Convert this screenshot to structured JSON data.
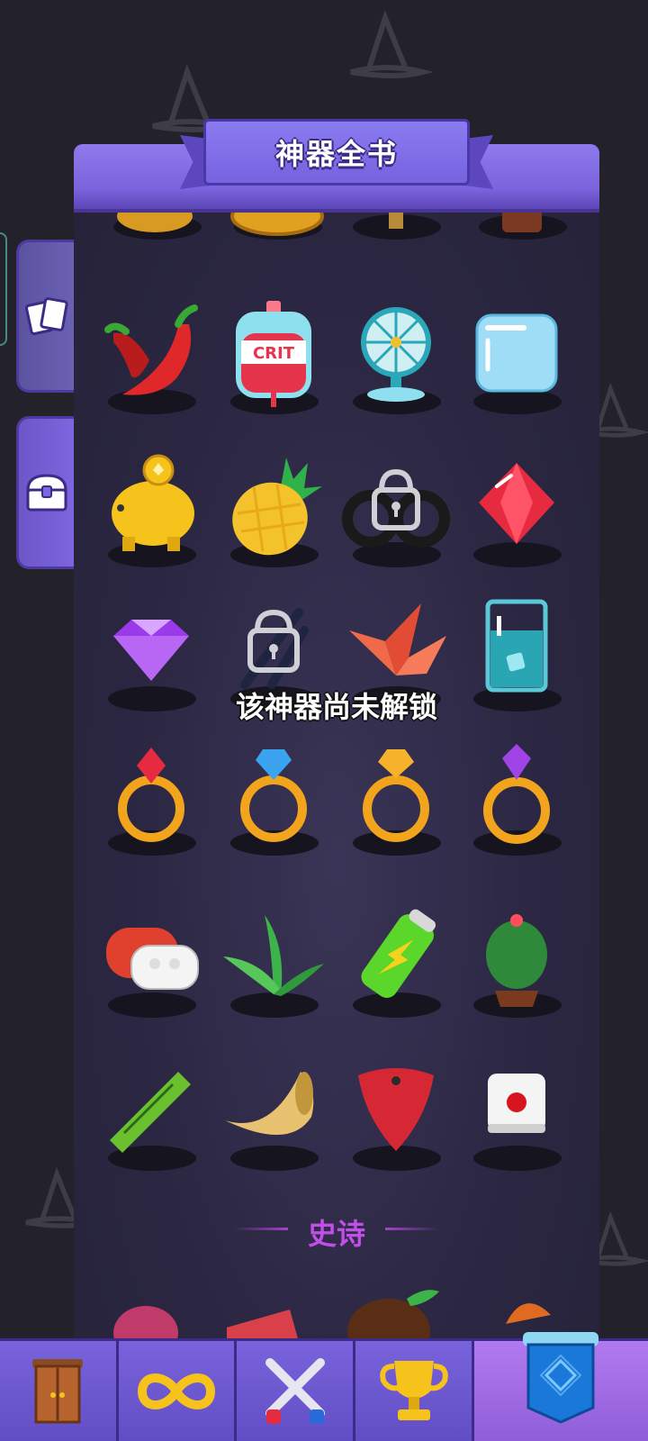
{
  "header": {
    "title": "神器全书"
  },
  "toast": {
    "locked_message": "该神器尚未解锁"
  },
  "section": {
    "epic_label": "史诗"
  },
  "side_tabs": [
    {
      "name": "cards",
      "icon": "cards-icon"
    },
    {
      "name": "chest",
      "icon": "chest-icon"
    }
  ],
  "artifacts": [
    {
      "name": "chili-pepper",
      "locked": false
    },
    {
      "name": "crit-blood-bag",
      "locked": false,
      "label": "CRIT"
    },
    {
      "name": "desk-fan",
      "locked": false
    },
    {
      "name": "ice-cube",
      "locked": false
    },
    {
      "name": "piggy-bank",
      "locked": false
    },
    {
      "name": "pineapple",
      "locked": false
    },
    {
      "name": "handcuffs",
      "locked": true
    },
    {
      "name": "red-ruby",
      "locked": false
    },
    {
      "name": "purple-diamond",
      "locked": false
    },
    {
      "name": "pliers",
      "locked": true
    },
    {
      "name": "paper-crane",
      "locked": false
    },
    {
      "name": "ice-water-glass",
      "locked": false
    },
    {
      "name": "ruby-ring",
      "locked": false
    },
    {
      "name": "sapphire-ring",
      "locked": false
    },
    {
      "name": "topaz-ring",
      "locked": false
    },
    {
      "name": "amethyst-ring",
      "locked": false
    },
    {
      "name": "earbuds-case",
      "locked": false
    },
    {
      "name": "aloe-plant",
      "locked": false
    },
    {
      "name": "battery",
      "locked": false
    },
    {
      "name": "cactus",
      "locked": false
    },
    {
      "name": "green-ruler",
      "locked": false
    },
    {
      "name": "horn",
      "locked": false
    },
    {
      "name": "guitar-pick",
      "locked": false
    },
    {
      "name": "dice",
      "locked": false
    }
  ],
  "bottom_nav": [
    {
      "name": "wardrobe",
      "icon": "wardrobe-icon"
    },
    {
      "name": "infinity",
      "icon": "infinity-icon"
    },
    {
      "name": "battle",
      "icon": "crossed-swords-icon"
    },
    {
      "name": "trophy",
      "icon": "trophy-icon"
    },
    {
      "name": "banner",
      "icon": "banner-icon",
      "active": true
    }
  ],
  "colors": {
    "accent": "#7a63dc",
    "epic": "#c14ee6",
    "bg": "#23212a"
  }
}
